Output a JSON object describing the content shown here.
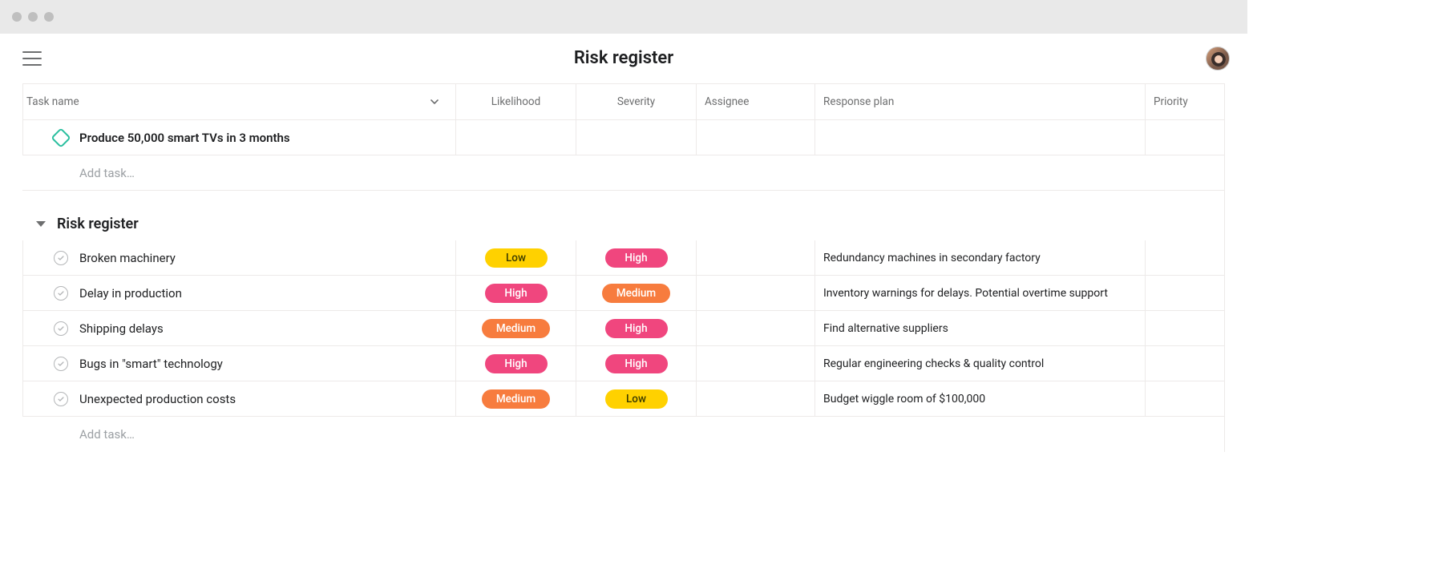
{
  "title": "Risk register",
  "columns": {
    "task": "Task name",
    "likelihood": "Likelihood",
    "severity": "Severity",
    "assignee": "Assignee",
    "response": "Response plan",
    "priority": "Priority"
  },
  "goal": {
    "name": "Produce 50,000 smart TVs in 3 months"
  },
  "add_task_label": "Add task…",
  "section": {
    "name": "Risk register"
  },
  "risks": [
    {
      "name": "Broken machinery",
      "likelihood": "Low",
      "severity": "High",
      "response": "Redundancy machines in secondary factory"
    },
    {
      "name": "Delay in production",
      "likelihood": "High",
      "severity": "Medium",
      "response": "Inventory warnings for delays. Potential overtime support"
    },
    {
      "name": "Shipping delays",
      "likelihood": "Medium",
      "severity": "High",
      "response": "Find alternative suppliers"
    },
    {
      "name": "Bugs in \"smart\" technology",
      "likelihood": "High",
      "severity": "High",
      "response": "Regular engineering checks & quality control"
    },
    {
      "name": "Unexpected production costs",
      "likelihood": "Medium",
      "severity": "Low",
      "response": "Budget wiggle room of $100,000"
    }
  ],
  "pill_classes": {
    "Low": "pill-low",
    "Medium": "pill-medium",
    "High": "pill-high"
  }
}
